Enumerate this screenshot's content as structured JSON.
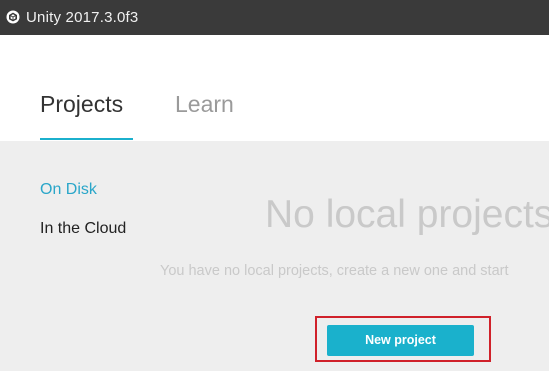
{
  "window": {
    "title": "Unity 2017.3.0f3",
    "icon": "unity-logo-icon"
  },
  "tabs": [
    {
      "label": "Projects",
      "active": true
    },
    {
      "label": "Learn",
      "active": false
    }
  ],
  "sidebar": {
    "items": [
      {
        "label": "On Disk",
        "active": true
      },
      {
        "label": "In the Cloud",
        "active": false
      }
    ]
  },
  "main": {
    "empty_title": "No local projects",
    "empty_subtitle": "You have no local projects, create a new one and start",
    "new_project_label": "New project"
  },
  "colors": {
    "accent": "#1ab1cc",
    "titlebar": "#3a3a3a",
    "highlight": "#d0212a"
  }
}
